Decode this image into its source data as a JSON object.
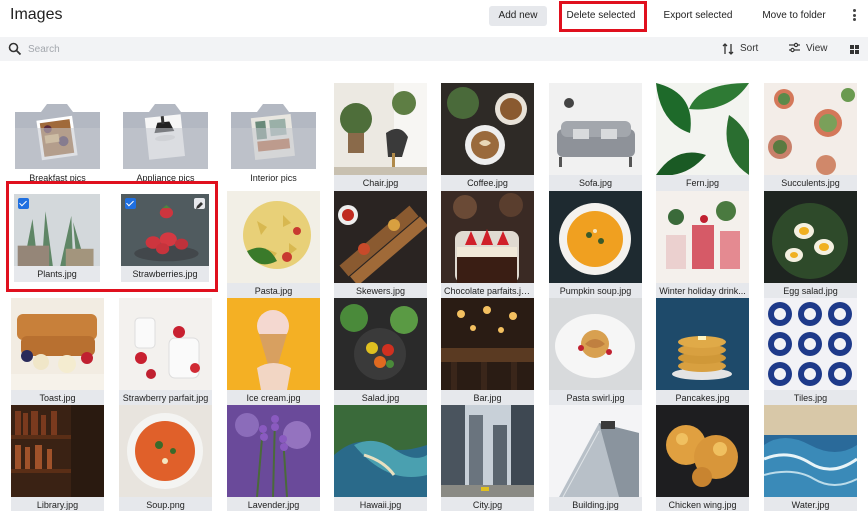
{
  "header": {
    "title": "Images",
    "add_new": "Add new",
    "delete_selected": "Delete selected",
    "export_selected": "Export selected",
    "move_to_folder": "Move to folder"
  },
  "toolbar": {
    "search_placeholder": "Search",
    "sort": "Sort",
    "view": "View"
  },
  "icons": [
    "more-vert-icon",
    "search-icon",
    "sort-icon",
    "filter-icon",
    "grid-view-icon",
    "checkbox-icon",
    "edit-icon",
    "folder-icon"
  ],
  "colors": {
    "highlight": "#e0101e",
    "checkbox": "#1f6fe0",
    "caption_bg": "#e6e8ec",
    "toolbar_bg": "#f2f3f5"
  },
  "items": [
    {
      "name": "Breakfast pics",
      "kind": "folder"
    },
    {
      "name": "Appliance pics",
      "kind": "folder"
    },
    {
      "name": "Interior pics",
      "kind": "folder"
    },
    {
      "name": "Chair.jpg",
      "kind": "image"
    },
    {
      "name": "Coffee.jpg",
      "kind": "image"
    },
    {
      "name": "Sofa.jpg",
      "kind": "image"
    },
    {
      "name": "Fern.jpg",
      "kind": "image"
    },
    {
      "name": "Succulents.jpg",
      "kind": "image"
    },
    {
      "name": "Plants.jpg",
      "kind": "image",
      "selected": true
    },
    {
      "name": "Strawberries.jpg",
      "kind": "image",
      "selected": true
    },
    {
      "name": "Pasta.jpg",
      "kind": "image"
    },
    {
      "name": "Skewers.jpg",
      "kind": "image"
    },
    {
      "name": "Chocolate parfaits.jpg",
      "kind": "image"
    },
    {
      "name": "Pumpkin soup.jpg",
      "kind": "image"
    },
    {
      "name": "Winter holiday drink...",
      "kind": "image"
    },
    {
      "name": "Egg salad.jpg",
      "kind": "image"
    },
    {
      "name": "Toast.jpg",
      "kind": "image"
    },
    {
      "name": "Strawberry parfait.jpg",
      "kind": "image"
    },
    {
      "name": "Ice cream.jpg",
      "kind": "image"
    },
    {
      "name": "Salad.jpg",
      "kind": "image"
    },
    {
      "name": "Bar.jpg",
      "kind": "image"
    },
    {
      "name": "Pasta swirl.jpg",
      "kind": "image"
    },
    {
      "name": "Pancakes.jpg",
      "kind": "image"
    },
    {
      "name": "Tiles.jpg",
      "kind": "image"
    },
    {
      "name": "Library.jpg",
      "kind": "image"
    },
    {
      "name": "Soup.png",
      "kind": "image"
    },
    {
      "name": "Lavender.jpg",
      "kind": "image"
    },
    {
      "name": "Hawaii.jpg",
      "kind": "image"
    },
    {
      "name": "City.jpg",
      "kind": "image"
    },
    {
      "name": "Building.jpg",
      "kind": "image"
    },
    {
      "name": "Chicken wing.jpg",
      "kind": "image"
    },
    {
      "name": "Water.jpg",
      "kind": "image"
    }
  ]
}
